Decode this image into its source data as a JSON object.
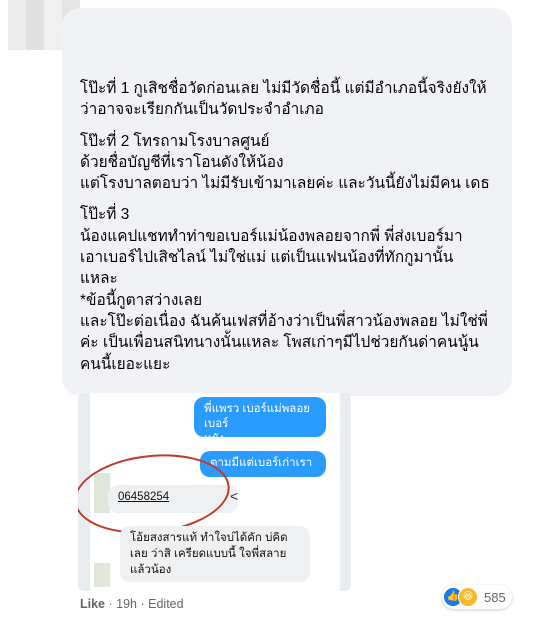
{
  "comment": {
    "paragraphs": [
      "โป๊ะที่ 1 กูเสิชชื่อวัดก่อนเลย ไม่มีวัดชื่อนี้ แต่มีอำเภอนี้จริงยังให้\nว่าอาจจะเรียกกันเป็นวัดประจำอำเภอ",
      "โป๊ะที่ 2 โทรถามโรงบาลศูนย์\nด้วยชื่อบัญชีที่เราโอนดังให้น้อง\nแต่โรงบาลตอบว่า ไม่มีรับเข้ามาเลยค่ะ และวันนี้ยังไม่มีคน เดธ",
      "โป๊ะที่ 3\nน้องแคปแชททำท่าขอเบอร์แม่น้องพลอยจากพี่ พี่ส่งเบอร์มา\nเอาเบอร์ไปเสิชไลน์ ไม่ใช่แม่ แต่เป็นแฟนน้องที่ทักกูมานั้น\nแหละ\n*ข้อนี้กูตาสว่างเลย\nและโป๊ะต่อเนื่อง ฉันค้นเฟสที่อ้างว่าเป็นพี่สาวน้องพลอย ไม่ใช่พี่\nค่ะ เป็นเพื่อนสนิทนางนั้นแหละ โพสเก่าๆมีไปช่วยกันด่าคนนู้น\nคนนี้เยอะแยะ"
    ]
  },
  "chat": {
    "msg1": "พี่แพรว เบอร์แม่พลอยเบอร์\nหยัง",
    "msg2": "ตามมีแต่เบอร์เก่าเรา",
    "number": "06458254",
    "msg3": "โอ้ยสงสารแท้ ทำใจบ่ได้คัก บ่คิด\nเลย ว่าสิ เครียดแบบนี้ ใจพี่สลาย\nแล้วน้อง"
  },
  "footer": {
    "like": "Like",
    "time": "19h",
    "edited": "Edited",
    "reactions": "585"
  },
  "icons": {
    "share": "share-icon",
    "like": "like-icon",
    "haha": "haha-icon"
  },
  "colors": {
    "bubble": "#f0f2f5",
    "chat_blue": "#2b9cff",
    "circle": "#c0392b"
  }
}
